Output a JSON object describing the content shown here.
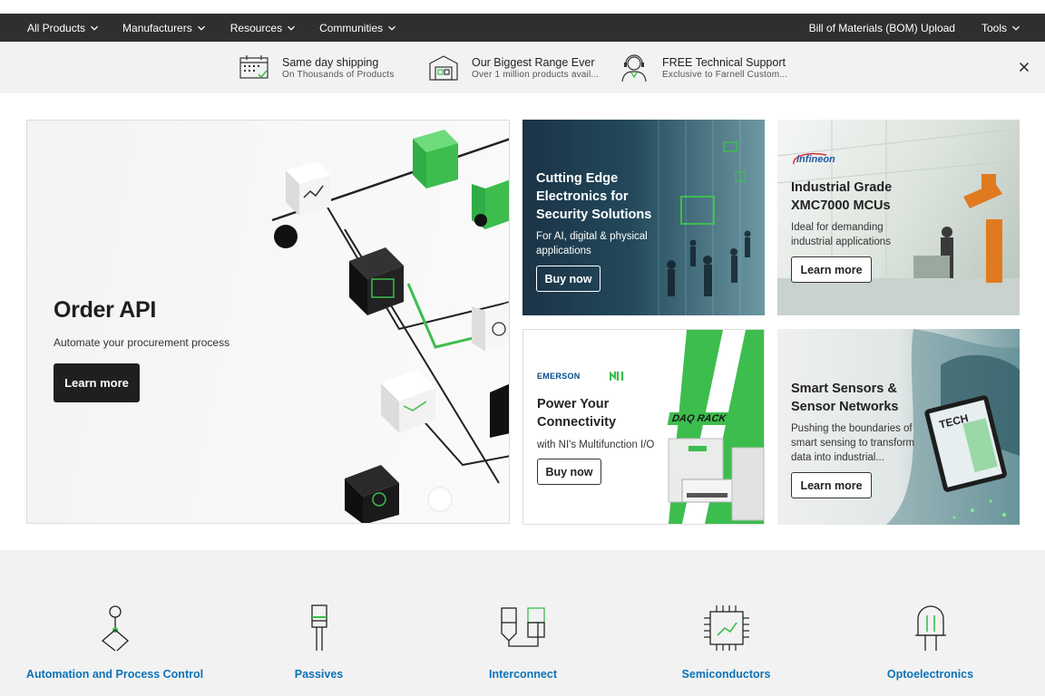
{
  "nav": {
    "left": [
      {
        "label": "All Products"
      },
      {
        "label": "Manufacturers"
      },
      {
        "label": "Resources"
      },
      {
        "label": "Communities"
      }
    ],
    "bom": "Bill of Materials (BOM) Upload",
    "tools": "Tools"
  },
  "benefits": [
    {
      "title": "Same day shipping",
      "sub": "On Thousands of Products",
      "icon": "calendar-truck-icon"
    },
    {
      "title": "Our Biggest Range Ever",
      "sub": "Over 1 million products avail...",
      "icon": "warehouse-icon"
    },
    {
      "title": "FREE Technical Support",
      "sub": "Exclusive to Farnell Custom...",
      "icon": "support-agent-icon"
    }
  ],
  "hero": {
    "title": "Order API",
    "subtitle": "Automate your procurement process",
    "button": "Learn more"
  },
  "cards": {
    "security": {
      "title_lines": [
        "Cutting Edge",
        "Electronics for",
        "Security Solutions"
      ],
      "desc_lines": [
        "For AI, digital & physical",
        "applications"
      ],
      "button": "Buy now"
    },
    "industrial": {
      "brand": "infineon",
      "title_lines": [
        "Industrial Grade",
        "XMC7000 MCUs"
      ],
      "desc_lines": [
        "Ideal for demanding",
        "industrial applications"
      ],
      "button": "Learn more"
    },
    "connectivity": {
      "brand": "EMERSON",
      "product_badge": "DAQ RACK",
      "title_lines": [
        "Power Your",
        "Connectivity"
      ],
      "desc_lines": [
        "with NI's Multifunction I/O"
      ],
      "button": "Buy now"
    },
    "sensors": {
      "magazine": "TECH",
      "title_lines": [
        "Smart Sensors &",
        "Sensor Networks"
      ],
      "desc_lines": [
        "Pushing the boundaries of",
        "smart sensing to transform",
        "data into industrial..."
      ],
      "button": "Learn more"
    }
  },
  "categories": [
    {
      "label": "Automation and Process Control",
      "icon": "automation-icon"
    },
    {
      "label": "Passives",
      "icon": "passives-icon"
    },
    {
      "label": "Interconnect",
      "icon": "interconnect-icon"
    },
    {
      "label": "Semiconductors",
      "icon": "semiconductor-icon"
    },
    {
      "label": "Optoelectronics",
      "icon": "optoelectronics-icon"
    }
  ],
  "colors": {
    "nav_bg": "#2f2f2f",
    "accent_green": "#3dbd4e",
    "link_blue": "#0b72b8",
    "strip_bg": "#f2f2f2"
  }
}
